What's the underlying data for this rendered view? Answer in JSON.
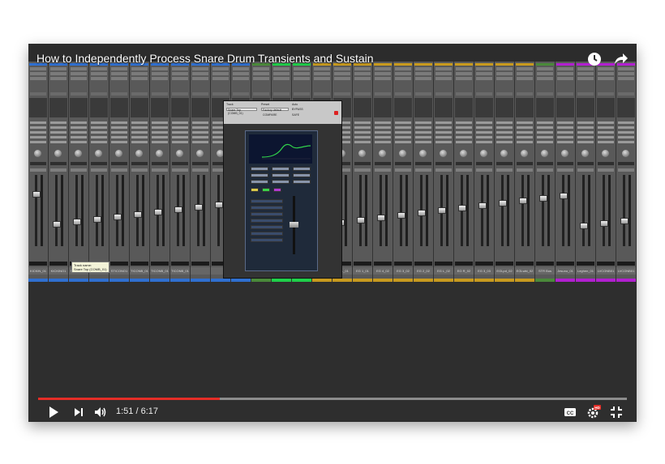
{
  "video": {
    "title": "How to Independently Process Snare Drum Transients and Sustain",
    "current_time": "1:51",
    "duration": "6:17",
    "time_separator": "/",
    "progress_played": 0.308,
    "progress_loaded": 1.0
  },
  "icons": {
    "watch_later": "clock-icon",
    "share": "share-arrow-icon",
    "play": "play-icon",
    "next": "next-icon",
    "volume": "volume-icon",
    "captions": "cc-icon",
    "settings": "gear-icon",
    "exit_fullscreen": "exit-fullscreen-icon"
  },
  "captions_label": "CC",
  "hd_badge": "HD",
  "mixer": {
    "tooltip_lines": [
      "Track name:",
      "Snare Top (COMB_01)"
    ],
    "tracks": [
      {
        "name": "KICKIN_01",
        "color": "#2f6fd0"
      },
      {
        "name": "KICKINO1",
        "color": "#2f6fd0"
      },
      {
        "name": "STICONO1",
        "color": "#2f6fd0"
      },
      {
        "name": "SBCONO01",
        "color": "#2f6fd0"
      },
      {
        "name": "STICONO1",
        "color": "#2f6fd0"
      },
      {
        "name": "TICONB_01",
        "color": "#2f6fd0"
      },
      {
        "name": "TICONB_01",
        "color": "#2f6fd0"
      },
      {
        "name": "TICONB_01",
        "color": "#2f6fd0"
      },
      {
        "name": "",
        "color": "#2f6fd0"
      },
      {
        "name": "",
        "color": "#2f6fd0"
      },
      {
        "name": "",
        "color": "#2f6fd0"
      },
      {
        "name": "",
        "color": "#4a8a3a"
      },
      {
        "name": "",
        "color": "#1fd04a"
      },
      {
        "name": "",
        "color": "#1fd04a"
      },
      {
        "name": "EG L_01",
        "color": "#c89a1e"
      },
      {
        "name": "EG L_01",
        "color": "#c89a1e"
      },
      {
        "name": "EG 1_01",
        "color": "#c89a1e"
      },
      {
        "name": "EG 4_02",
        "color": "#c89a1e"
      },
      {
        "name": "EG 3_02",
        "color": "#c89a1e"
      },
      {
        "name": "EG 2_02",
        "color": "#c89a1e"
      },
      {
        "name": "EG L_02",
        "color": "#c89a1e"
      },
      {
        "name": "EG R_02",
        "color": "#c89a1e"
      },
      {
        "name": "EG 3_03",
        "color": "#c89a1e"
      },
      {
        "name": "EGLpd_02",
        "color": "#c89a1e"
      },
      {
        "name": "EGLwkt_02",
        "color": "#c89a1e"
      },
      {
        "name": "STR Bus",
        "color": "#4a8a3a"
      },
      {
        "name": "Jesuno_01",
        "color": "#b21fd0"
      },
      {
        "name": "Leghen_01",
        "color": "#b21fd0"
      },
      {
        "name": "LVCONB01",
        "color": "#b21fd0"
      },
      {
        "name": "LVCONB01",
        "color": "#b21fd0"
      }
    ]
  },
  "plugin": {
    "track_label": "Track",
    "preset_label": "Preset",
    "auto_label": "Auto",
    "track_value": "Snare Top (COMB_01)",
    "preset_value": "Factory default",
    "compare_label": "COMPARE",
    "bypass_label": "BYPASS",
    "safe_label": "SAFE"
  }
}
